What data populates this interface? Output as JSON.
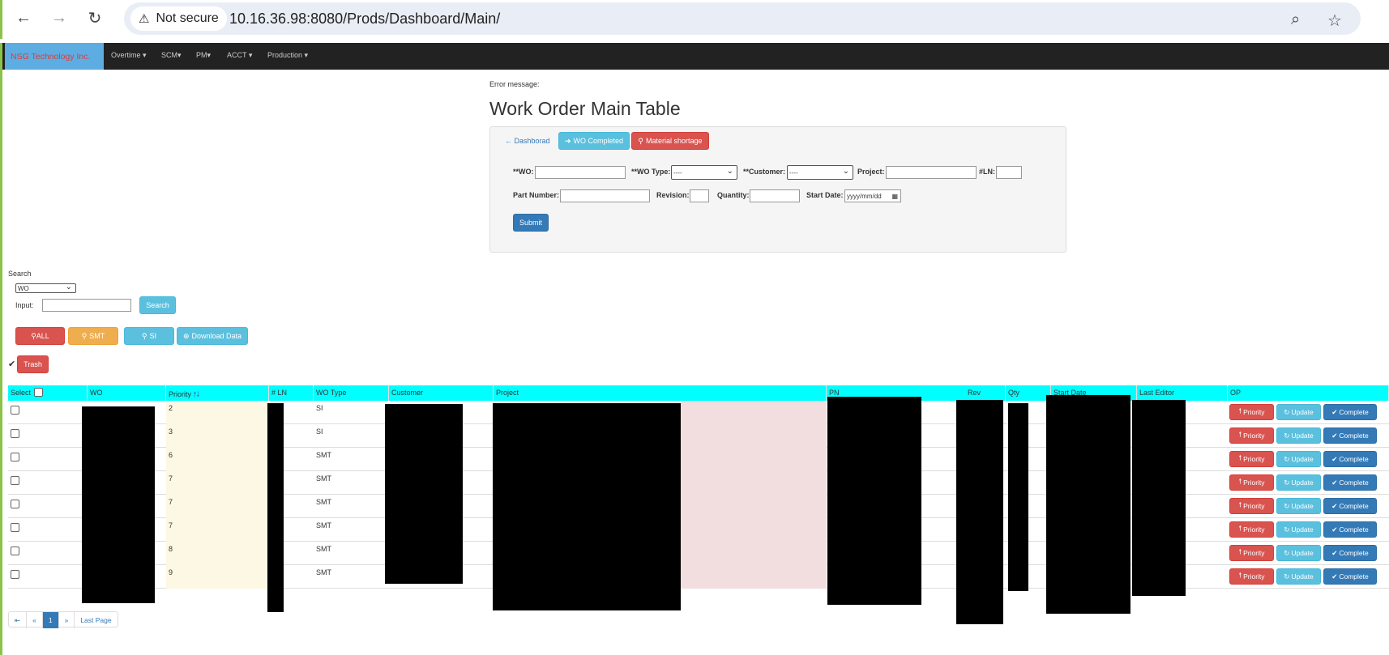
{
  "browser": {
    "security_label": "Not secure",
    "url": "10.16.36.98:8080/Prods/Dashboard/Main/"
  },
  "nav": {
    "brand": "NSG Technology Inc.",
    "items": [
      "Overtime",
      "SCM",
      "PM",
      "ACCT",
      "Production"
    ]
  },
  "page": {
    "error_message": "Error message:",
    "title": "Work Order Main Table"
  },
  "form": {
    "dashboard_link": "Dashborad",
    "wo_completed": "WO Completed",
    "material_shortage": "Material shortage",
    "wo_label": "**WO:",
    "wo_type_label": "**WO Type:",
    "wo_type_value": "----",
    "customer_label": "**Customer:",
    "customer_value": "----",
    "project_label": "Project:",
    "ln_label": "#LN:",
    "part_number_label": "Part Number:",
    "revision_label": "Revision:",
    "quantity_label": "Quantity:",
    "start_date_label": "Start Date:",
    "start_date_placeholder": "yyyy/mm/dd",
    "submit": "Submit"
  },
  "search": {
    "label": "Search",
    "field_value": "WO",
    "input_label": "Input:",
    "button": "Search"
  },
  "filters": {
    "all": "ALL",
    "smt": "SMT",
    "si": "SI",
    "download": "Download Data",
    "trash": "Trash"
  },
  "table": {
    "headers": [
      "Select",
      "WO",
      "Priority",
      "# LN",
      "WO Type",
      "Customer",
      "Project",
      "PN",
      "Rev",
      "Qty",
      "Start Date",
      "Last Editor",
      "OP"
    ],
    "rows": [
      {
        "priority": "2",
        "type": "SI"
      },
      {
        "priority": "3",
        "type": "SI"
      },
      {
        "priority": "6",
        "type": "SMT"
      },
      {
        "priority": "7",
        "type": "SMT"
      },
      {
        "priority": "7",
        "type": "SMT"
      },
      {
        "priority": "7",
        "type": "SMT"
      },
      {
        "priority": "8",
        "type": "SMT"
      },
      {
        "priority": "9",
        "type": "SMT"
      }
    ],
    "op_priority": "Priority",
    "op_update": "Update",
    "op_complete": "Complete"
  },
  "pagination": {
    "first": "⇤",
    "prev": "«",
    "current": "1",
    "next": "»",
    "last": "Last Page"
  }
}
